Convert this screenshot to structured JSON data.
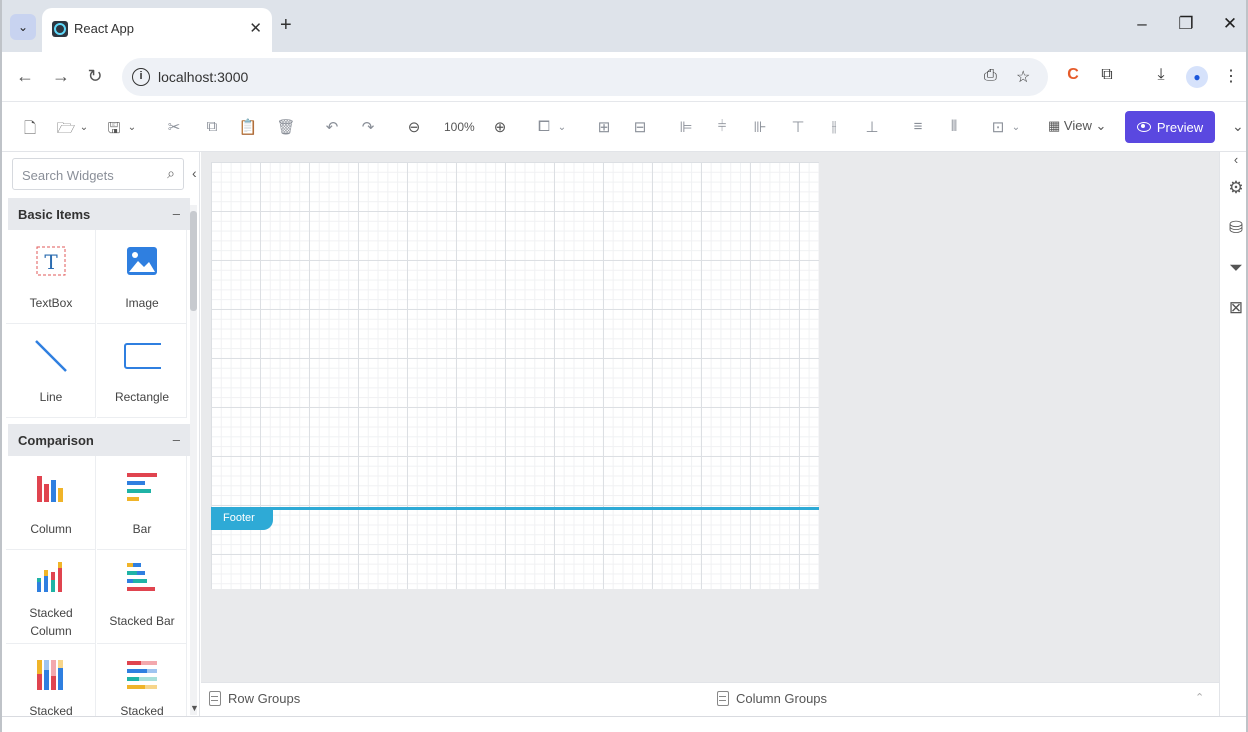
{
  "browser": {
    "tab_title": "React App",
    "tab_close": "✕",
    "new_tab": "+",
    "tab_menu": "⌄",
    "url": "localhost:3000",
    "window_controls": {
      "minimize": "–",
      "restore": "❐",
      "close": "✕"
    },
    "icons": [
      "back-arrow-icon",
      "forward-arrow-icon",
      "reload-icon",
      "info-icon",
      "install-icon",
      "star-icon",
      "extension-icon",
      "download-icon",
      "profile-icon",
      "kebab-menu-icon"
    ]
  },
  "toolbar": {
    "zoom_level": "100%",
    "view_label": "View",
    "preview_label": "Preview",
    "accent_color": "#5a48e0"
  },
  "panel": {
    "search_placeholder": "Search Widgets",
    "categories": [
      {
        "label": "Basic Items",
        "toggle": "–",
        "items": [
          {
            "label": "TextBox",
            "icon": "textbox-icon"
          },
          {
            "label": "Image",
            "icon": "image-icon"
          },
          {
            "label": "Line",
            "icon": "line-icon"
          },
          {
            "label": "Rectangle",
            "icon": "rectangle-icon"
          }
        ]
      },
      {
        "label": "Comparison",
        "toggle": "–",
        "items": [
          {
            "label": "Column",
            "icon": "column-chart-icon"
          },
          {
            "label": "Bar",
            "icon": "bar-chart-icon"
          },
          {
            "label_lines": [
              "Stacked",
              "Column"
            ],
            "icon": "stacked-column-chart-icon"
          },
          {
            "label": "Stacked Bar",
            "icon": "stacked-bar-chart-icon"
          },
          {
            "label": "Stacked",
            "icon": "stacked-column-100-icon"
          },
          {
            "label": "Stacked",
            "icon": "stacked-bar-100-icon"
          }
        ]
      }
    ]
  },
  "canvas": {
    "footer_label": "Footer",
    "footer_color": "#2eaad6"
  },
  "groups": {
    "row_groups_label": "Row Groups",
    "column_groups_label": "Column Groups"
  }
}
